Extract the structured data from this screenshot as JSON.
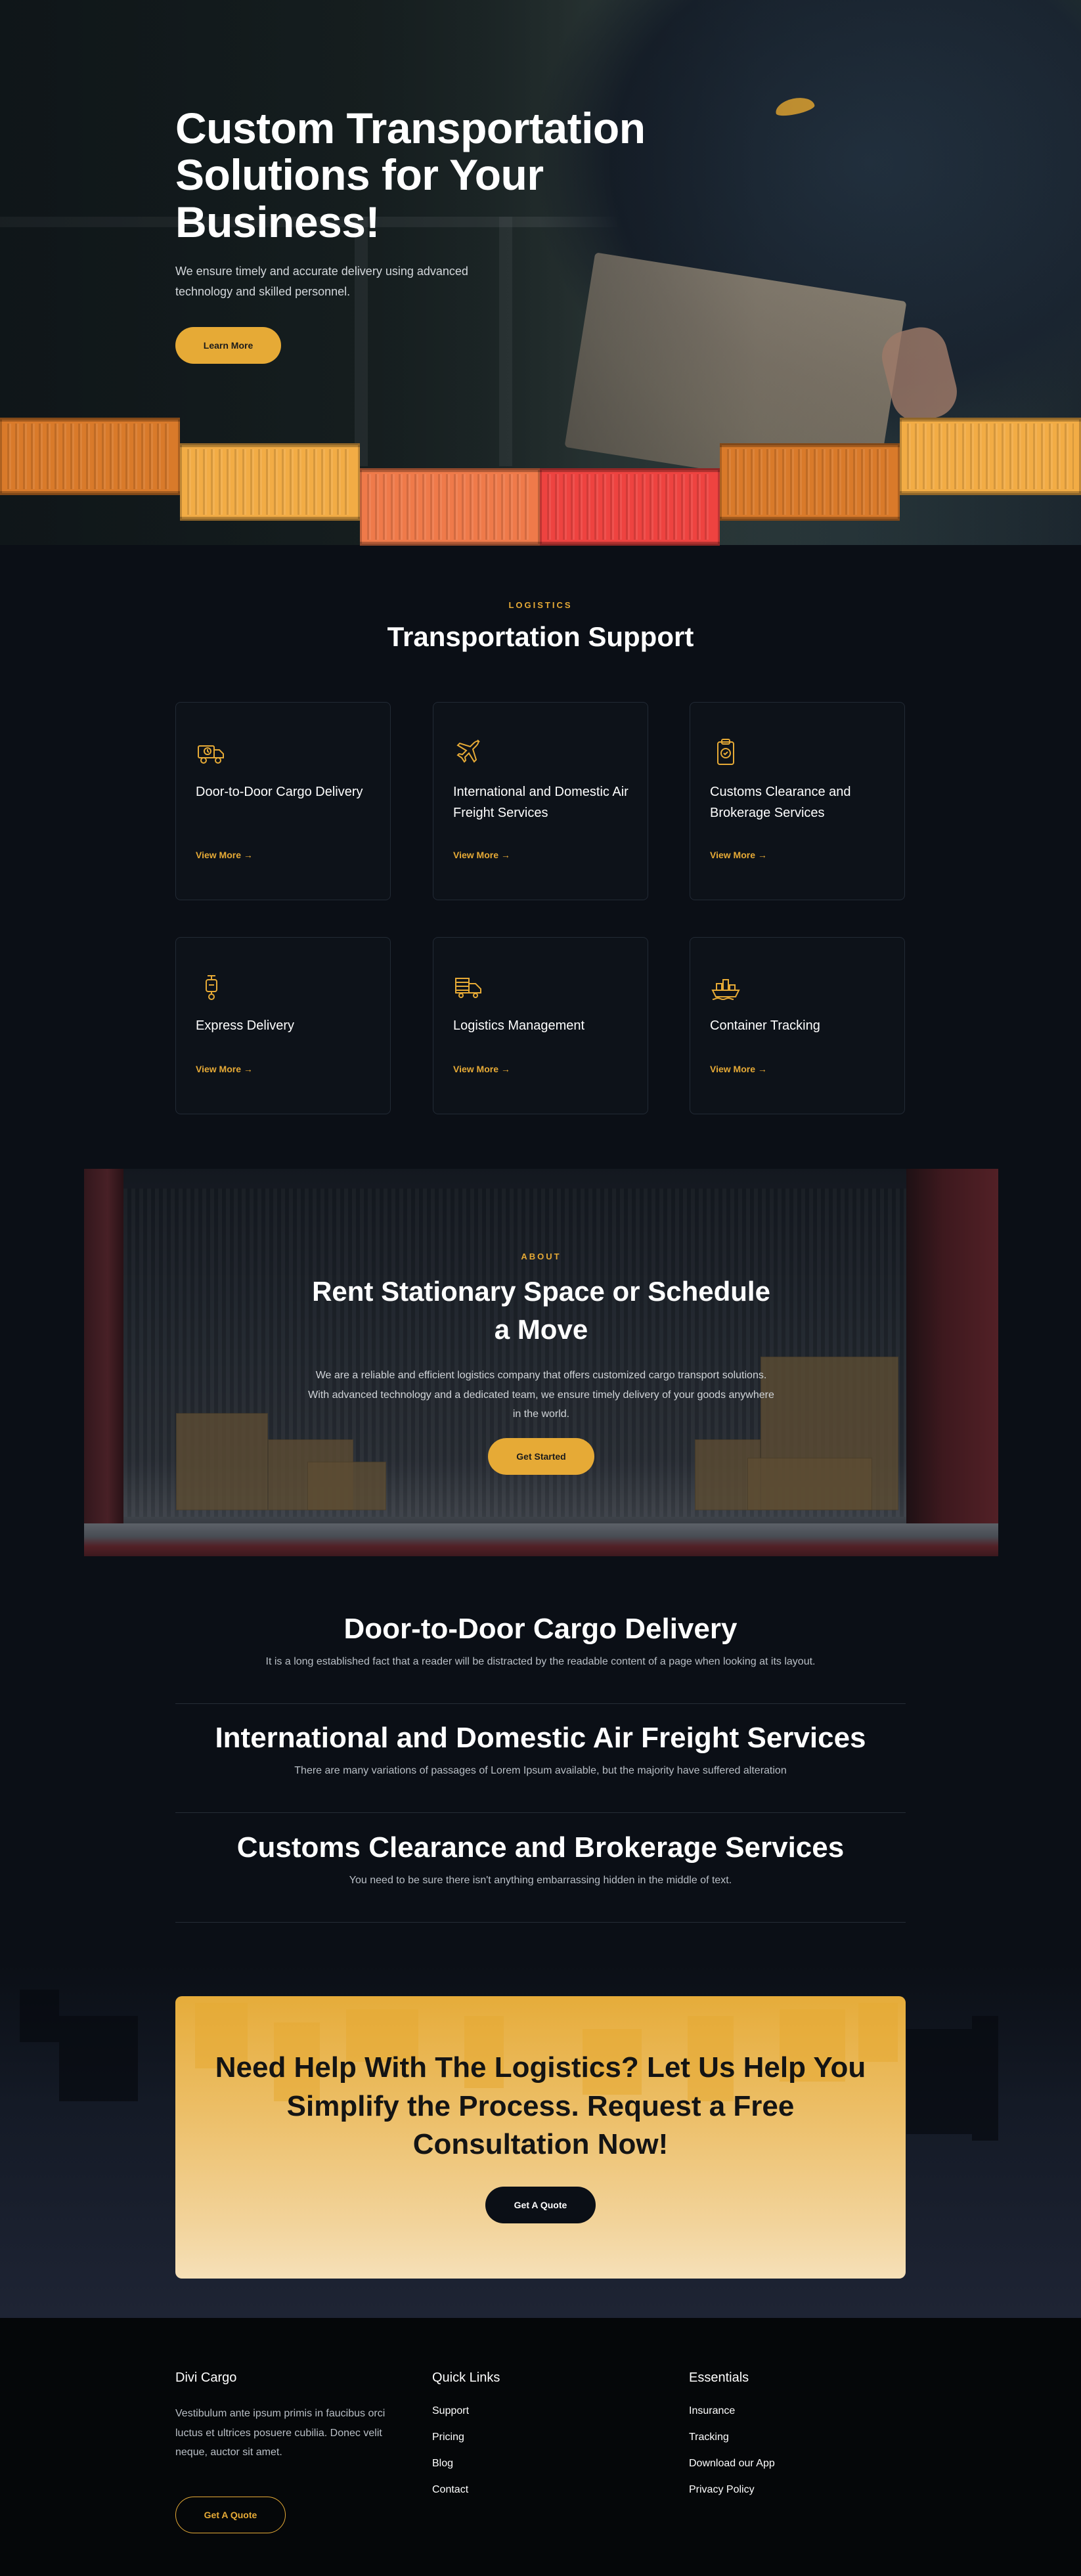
{
  "hero": {
    "title": "Custom Transportation Solutions for Your Business!",
    "subtitle": "We ensure timely and accurate delivery using advanced technology and skilled personnel.",
    "button": "Learn More"
  },
  "containers": [
    {
      "color": "#d97a2a"
    },
    {
      "color": "#f2ac45"
    },
    {
      "color": "#ef7a4a"
    },
    {
      "color": "#ee4340"
    },
    {
      "color": "#d97a2a"
    },
    {
      "color": "#f2ac45"
    }
  ],
  "logistics": {
    "eyebrow": "LOGISTICS",
    "title": "Transportation Support",
    "cards": [
      {
        "title": "Door-to-Door Cargo Delivery",
        "link": "View More →",
        "icon": "delivery-truck-icon"
      },
      {
        "title": "International and Domestic Air Freight Services",
        "link": "View More →",
        "icon": "airplane-icon"
      },
      {
        "title": "Customs Clearance and Brokerage Services",
        "link": "View More →",
        "icon": "clipboard-check-icon"
      },
      {
        "title": "Express Delivery",
        "link": "View More →",
        "icon": "scooter-icon"
      },
      {
        "title": "Logistics Management",
        "link": "View More →",
        "icon": "warehouse-truck-icon"
      },
      {
        "title": "Container Tracking",
        "link": "View More →",
        "icon": "cargo-ship-icon"
      }
    ]
  },
  "about": {
    "eyebrow": "ABOUT",
    "title": "Rent Stationary Space or Schedule a Move",
    "text": "We are a reliable and efficient logistics company that offers customized cargo transport solutions. With advanced technology and a dedicated team, we ensure timely delivery of your goods anywhere in the world.",
    "button": "Get Started"
  },
  "features": [
    {
      "title": "Door-to-Door Cargo Delivery",
      "text": "It is a long established fact that a reader will be distracted by the readable content of a page when looking at its layout."
    },
    {
      "title": "International and Domestic Air Freight Services",
      "text": "There are many variations of passages of Lorem Ipsum available, but the majority have suffered alteration"
    },
    {
      "title": "Customs Clearance and Brokerage Services",
      "text": "You need to be sure there isn't anything embarrassing hidden in the middle of text."
    }
  ],
  "cta": {
    "title": "Need Help With The Logistics? Let Us Help You Simplify the Process. Request a Free Consultation Now!",
    "button": "Get A Quote"
  },
  "footer": {
    "brand": "Divi Cargo",
    "about": "Vestibulum ante ipsum primis in faucibus orci luctus et ultrices posuere cubilia. Donec velit neque, auctor sit amet.",
    "button": "Get A Quote",
    "quick_links_title": "Quick Links",
    "quick_links": [
      "Support",
      "Pricing",
      "Blog",
      "Contact"
    ],
    "essentials_title": "Essentials",
    "essentials": [
      "Insurance",
      "Tracking",
      "Download our App",
      "Privacy Policy"
    ]
  },
  "colors": {
    "accent": "#e6aa36",
    "background": "#0b0f16"
  }
}
